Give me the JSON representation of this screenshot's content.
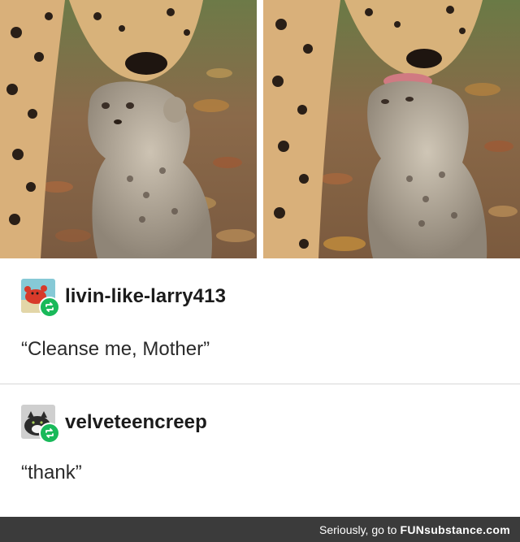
{
  "photos": [
    {
      "subject": "cheetah-mother-and-cub-left"
    },
    {
      "subject": "cheetah-mother-licking-cub-right"
    }
  ],
  "posts": [
    {
      "username": "livin-like-larry413",
      "text": "“Cleanse me, Mother”",
      "avatar_icon": "red-crab-avatar",
      "badge_icon": "reblog-icon"
    },
    {
      "username": "velveteencreep",
      "text": "“thank”",
      "avatar_icon": "cat-avatar",
      "badge_icon": "reblog-icon"
    }
  ],
  "footer": {
    "prefix": "Seriously, go to",
    "brand_fun": "FUN",
    "brand_rest": "substance.com"
  },
  "colors": {
    "reblog_badge": "#19b95a",
    "footer_bg": "#3b3b3b"
  }
}
